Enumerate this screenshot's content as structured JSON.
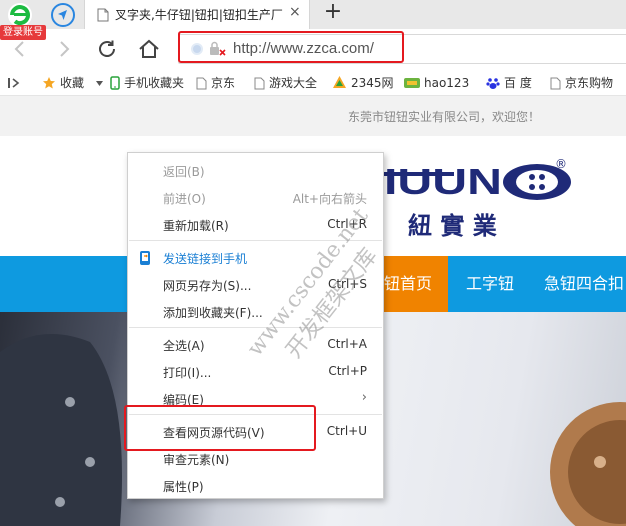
{
  "browser": {
    "login_badge": "登录账号",
    "tab": {
      "title": "叉字夹,牛仔钮|钮扣|钮扣生产厂家",
      "close": "×"
    },
    "new_tab": "+",
    "address": {
      "url": "http://www.zzca.com/"
    },
    "bookmarks": [
      {
        "label": "收藏",
        "icon": "star-icon"
      },
      {
        "label": "手机收藏夹",
        "icon": "phone-icon"
      },
      {
        "label": "京东",
        "icon": "page-icon"
      },
      {
        "label": "游戏大全",
        "icon": "page-icon"
      },
      {
        "label": "2345网",
        "icon": "logo-2345-icon"
      },
      {
        "label": "hao123",
        "icon": "logo-hao-icon"
      },
      {
        "label": "百 度",
        "icon": "baidu-paw-icon"
      },
      {
        "label": "京东购物",
        "icon": "page-icon"
      }
    ]
  },
  "site": {
    "welcome": "东莞市钮钮实业有限公司，欢迎您！",
    "logo_letters": "IUUN",
    "logo_cn": "紐 實 業",
    "logo_reg": "®",
    "nav": [
      "钮首页",
      "工字钮",
      "急钮四合扣"
    ]
  },
  "context_menu": {
    "items": [
      {
        "label": "返回(B)",
        "shortcut": "",
        "state": "disabled"
      },
      {
        "label": "前进(O)",
        "shortcut": "Alt+向右箭头",
        "state": "disabled"
      },
      {
        "label": "重新加载(R)",
        "shortcut": "Ctrl+R",
        "state": "normal"
      },
      {
        "label": "发送链接到手机",
        "shortcut": "",
        "state": "blue"
      },
      {
        "label": "网页另存为(S)...",
        "shortcut": "Ctrl+S",
        "state": "normal"
      },
      {
        "label": "添加到收藏夹(F)...",
        "shortcut": "",
        "state": "normal"
      },
      {
        "label": "全选(A)",
        "shortcut": "Ctrl+A",
        "state": "normal"
      },
      {
        "label": "打印(I)...",
        "shortcut": "Ctrl+P",
        "state": "normal"
      },
      {
        "label": "编码(E)",
        "shortcut": "",
        "state": "normal"
      },
      {
        "label": "查看网页源代码(V)",
        "shortcut": "Ctrl+U",
        "state": "normal"
      },
      {
        "label": "审查元素(N)",
        "shortcut": "",
        "state": "normal"
      },
      {
        "label": "属性(P)",
        "shortcut": "",
        "state": "normal"
      }
    ],
    "submenu_arrow": "›"
  },
  "watermark": {
    "line1": "www.cscode.net",
    "line2": "开发框架文库"
  },
  "colors": {
    "highlight": "#e4191f",
    "nav_bg": "#0e9ae0",
    "nav_active": "#f08300",
    "menu_blue": "#1a7fd4"
  }
}
